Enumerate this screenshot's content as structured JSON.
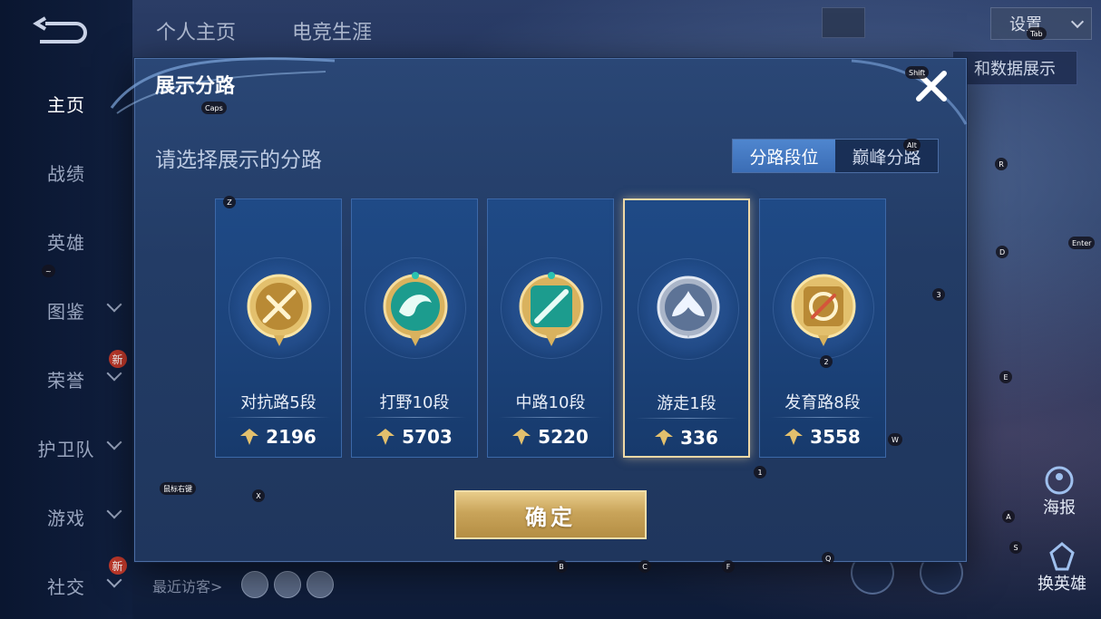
{
  "sidebar": {
    "items": [
      {
        "label": "主页",
        "active": true
      },
      {
        "label": "战绩"
      },
      {
        "label": "英雄"
      },
      {
        "label": "图鉴",
        "has_chevron": true
      },
      {
        "label": "荣誉",
        "has_chevron": true,
        "badge": "新"
      },
      {
        "label": "护卫队",
        "has_chevron": true
      },
      {
        "label": "游戏",
        "has_chevron": true
      },
      {
        "label": "社交",
        "has_chevron": true,
        "badge": "新"
      }
    ]
  },
  "top_tabs": [
    "个人主页",
    "电竞生涯"
  ],
  "top_right": {
    "settings_label": "设置",
    "data_show_label": "和数据展示",
    "poster_label": "海报",
    "change_hero_label": "换英雄"
  },
  "visitors": {
    "label": "最近访客>"
  },
  "modal": {
    "title": "展示分路",
    "subtitle": "请选择展示的分路",
    "toggle": [
      {
        "label": "分路段位",
        "active": true
      },
      {
        "label": "巅峰分路",
        "active": false
      }
    ],
    "cards": [
      {
        "rank": "对抗路5段",
        "score": "2196",
        "emblem": "sword-crest-icon",
        "theme": "gold",
        "selected": false
      },
      {
        "rank": "打野10段",
        "score": "5703",
        "emblem": "dragon-crest-icon",
        "theme": "teal",
        "selected": false
      },
      {
        "rank": "中路10段",
        "score": "5220",
        "emblem": "slash-crest-icon",
        "theme": "teal",
        "selected": false
      },
      {
        "rank": "游走1段",
        "score": "336",
        "emblem": "wing-crest-icon",
        "theme": "silver",
        "selected": true
      },
      {
        "rank": "发育路8段",
        "score": "3558",
        "emblem": "bow-crest-icon",
        "theme": "gold",
        "selected": false
      }
    ],
    "confirm_label": "确定"
  },
  "key_hints": [
    "Caps",
    "Shift",
    "Alt",
    "Tab",
    "Z",
    "R",
    "D",
    "Enter",
    "3",
    "2",
    "E",
    "W",
    "1",
    "X",
    "A",
    "S",
    "B",
    "C",
    "F",
    "Q",
    "~",
    "鼠标右键"
  ],
  "colors": {
    "accent_blue": "#3b6db5",
    "gold": "#c9a45a",
    "selected_border": "#f0d9a6"
  }
}
